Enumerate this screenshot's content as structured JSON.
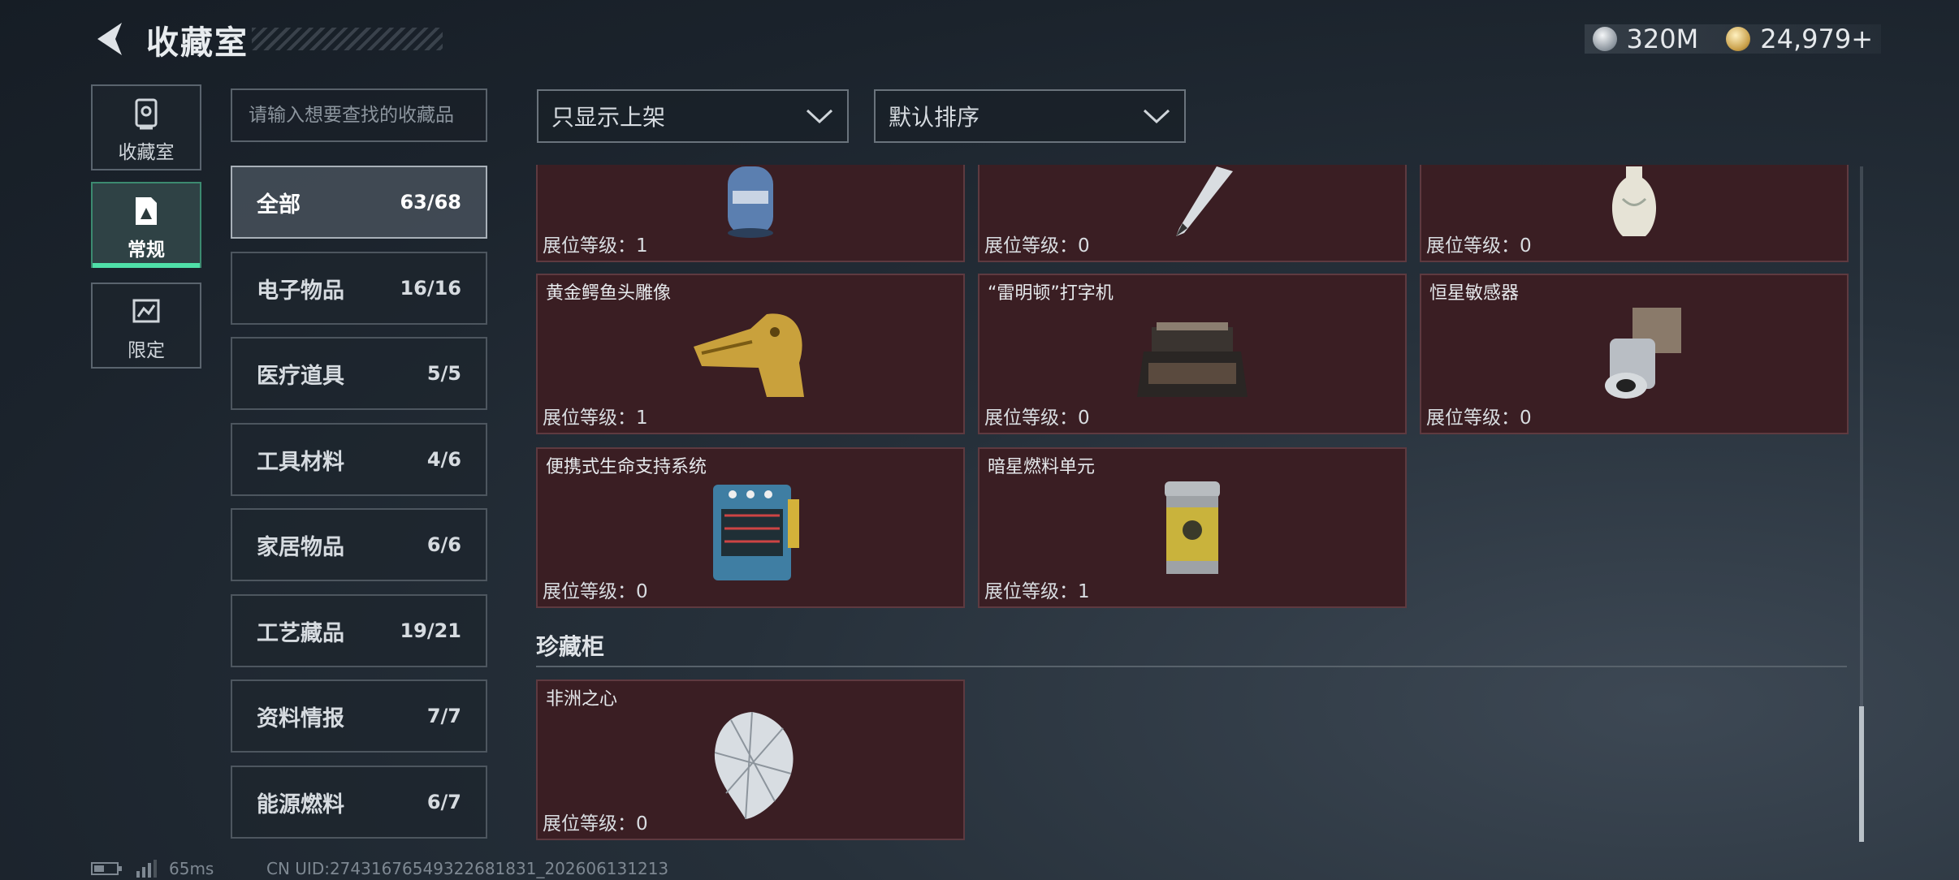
{
  "header": {
    "title": "收藏室",
    "currency": [
      {
        "icon": "silver-coin-icon",
        "value": "320M"
      },
      {
        "icon": "gold-coin-icon",
        "value": "24,979+"
      }
    ]
  },
  "side_nav": [
    {
      "label": "收藏室",
      "icon": "safe-icon",
      "active": false
    },
    {
      "label": "常规",
      "icon": "document-icon",
      "active": true
    },
    {
      "label": "限定",
      "icon": "map-icon",
      "active": false
    }
  ],
  "search": {
    "placeholder": "请输入想要查找的收藏品"
  },
  "categories": [
    {
      "name": "全部",
      "count": "63/68",
      "active": true
    },
    {
      "name": "电子物品",
      "count": "16/16"
    },
    {
      "name": "医疗道具",
      "count": "5/5"
    },
    {
      "name": "工具材料",
      "count": "4/6"
    },
    {
      "name": "家居物品",
      "count": "6/6"
    },
    {
      "name": "工艺藏品",
      "count": "19/21"
    },
    {
      "name": "资料情报",
      "count": "7/7"
    },
    {
      "name": "能源燃料",
      "count": "6/7"
    }
  ],
  "filters": {
    "shelf_filter": "只显示上架",
    "sort": "默认排序"
  },
  "level_prefix": "展位等级：",
  "items": [
    {
      "name": "",
      "level": "1",
      "icon": "gas-canister-icon"
    },
    {
      "name": "",
      "level": "0",
      "icon": "fountain-pen-icon"
    },
    {
      "name": "",
      "level": "0",
      "icon": "vase-icon"
    },
    {
      "name": "黄金鳄鱼头雕像",
      "level": "1",
      "icon": "golden-crocodile-statue-icon"
    },
    {
      "name": "“雷明顿”打字机",
      "level": "0",
      "icon": "typewriter-icon"
    },
    {
      "name": "恒星敏感器",
      "level": "0",
      "icon": "star-sensor-icon"
    },
    {
      "name": "便携式生命支持系统",
      "level": "0",
      "icon": "life-support-system-icon"
    },
    {
      "name": "暗星燃料单元",
      "level": "1",
      "icon": "fuel-cell-icon"
    }
  ],
  "treasure_section": {
    "title": "珍藏柜",
    "items": [
      {
        "name": "非洲之心",
        "level": "0",
        "icon": "diamond-icon"
      }
    ]
  },
  "status": {
    "ping": "65ms",
    "uid": "CN UID:27431676549322681831_202606131213"
  },
  "colors": {
    "card_bg": "#3a1e23",
    "active_tab_accent": "#4fe0a8"
  }
}
